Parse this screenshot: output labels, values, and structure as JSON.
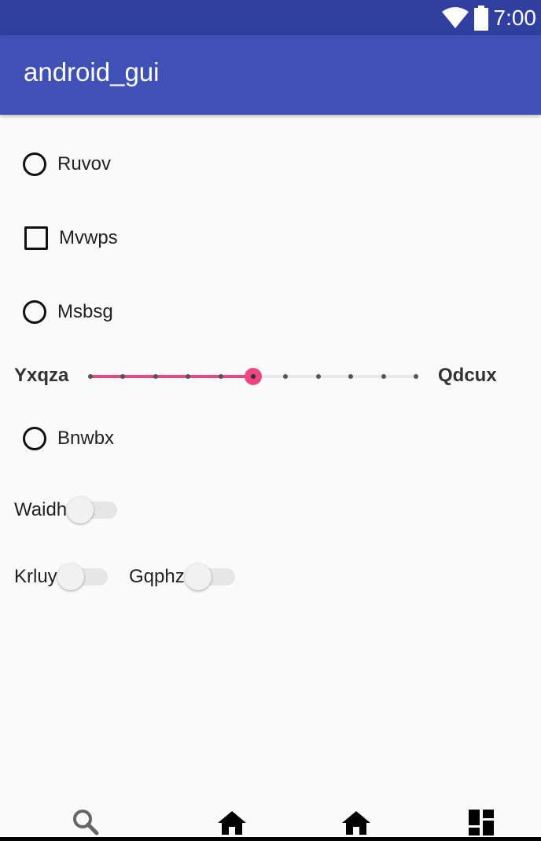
{
  "status_bar": {
    "time": "7:00",
    "icons": [
      "wifi-icon",
      "battery-icon"
    ]
  },
  "app_bar": {
    "title": "android_gui"
  },
  "controls": {
    "radio_1": {
      "label": "Ruvov",
      "checked": false
    },
    "checkbox_1": {
      "label": "Mvwps",
      "checked": false
    },
    "radio_2": {
      "label": "Msbsg",
      "checked": false
    },
    "slider": {
      "left_label": "Yxqza",
      "right_label": "Qdcux",
      "steps": 10,
      "value": 5
    },
    "radio_3": {
      "label": "Bnwbx",
      "checked": false
    },
    "switch_1": {
      "label": "Waidh",
      "on": false
    },
    "switch_2": {
      "label": "Krluy",
      "on": false
    },
    "switch_3": {
      "label": "Gqphz",
      "on": false
    }
  },
  "bottom_nav": [
    "search-icon",
    "home-icon",
    "home-icon",
    "dashboard-icon"
  ],
  "colors": {
    "status_bar": "#303f9f",
    "app_bar": "#3f51b5",
    "accent": "#f0467e",
    "background": "#fafafa"
  }
}
